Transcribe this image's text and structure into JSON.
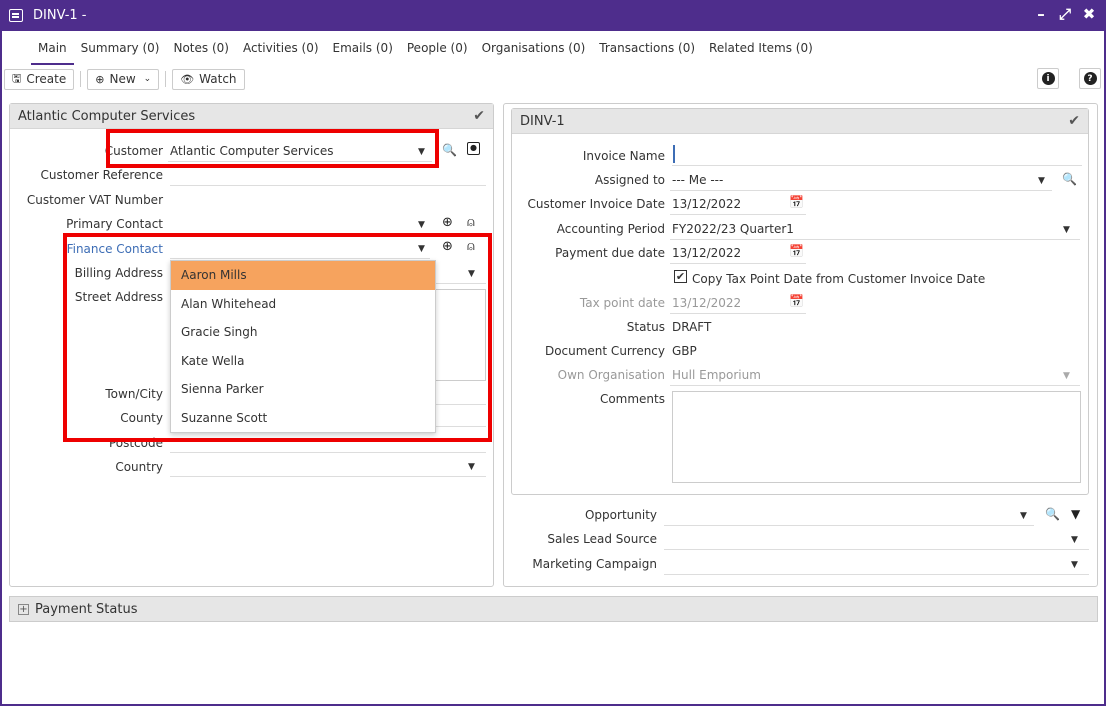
{
  "window": {
    "title": "DINV-1 -",
    "minimize": "–",
    "maximize": "⤢",
    "close": "✖"
  },
  "tabs": [
    {
      "label": "Main"
    },
    {
      "label": "Summary (0)"
    },
    {
      "label": "Notes (0)"
    },
    {
      "label": "Activities (0)"
    },
    {
      "label": "Emails (0)"
    },
    {
      "label": "People (0)"
    },
    {
      "label": "Organisations (0)"
    },
    {
      "label": "Transactions (0)"
    },
    {
      "label": "Related Items (0)"
    }
  ],
  "toolbar": {
    "create": "Create",
    "new": "New",
    "watch": "Watch",
    "info": "i",
    "help": "?"
  },
  "left_panel": {
    "title": "Atlantic Computer Services",
    "customer_label": "Customer",
    "customer_value": "Atlantic Computer Services",
    "customer_reference_label": "Customer Reference",
    "customer_vat_label": "Customer VAT Number",
    "primary_contact_label": "Primary Contact",
    "finance_contact_label": "Finance Contact",
    "billing_address_label": "Billing Address",
    "street_address_label": "Street Address",
    "town_label": "Town/City",
    "county_label": "County",
    "postcode_label": "Postcode",
    "country_label": "Country"
  },
  "dropdown": {
    "options": [
      "Aaron Mills",
      "Alan Whitehead",
      "Gracie Singh",
      "Kate Wella",
      "Sienna Parker",
      "Suzanne Scott"
    ]
  },
  "right_panel": {
    "title": "DINV-1",
    "invoice_name_label": "Invoice Name",
    "assigned_to_label": "Assigned to",
    "assigned_to_value": "--- Me ---",
    "customer_invoice_date_label": "Customer Invoice Date",
    "customer_invoice_date_value": "13/12/2022",
    "accounting_period_label": "Accounting Period",
    "accounting_period_value": "FY2022/23 Quarter1",
    "payment_due_label": "Payment due date",
    "payment_due_value": "13/12/2022",
    "copy_tax_label": "Copy Tax Point Date from Customer Invoice Date",
    "tax_point_label": "Tax point date",
    "tax_point_value": "13/12/2022",
    "status_label": "Status",
    "status_value": "DRAFT",
    "currency_label": "Document Currency",
    "currency_value": "GBP",
    "own_org_label": "Own Organisation",
    "own_org_value": "Hull Emporium",
    "comments_label": "Comments"
  },
  "extra": {
    "opportunity_label": "Opportunity",
    "sales_lead_label": "Sales Lead Source",
    "marketing_label": "Marketing Campaign"
  },
  "payment_status": {
    "title": "Payment Status"
  },
  "colors": {
    "titlebar": "#4e2d8c",
    "highlight": "#f6a35e",
    "annotation": "#e00000",
    "link": "#3d6db5"
  }
}
